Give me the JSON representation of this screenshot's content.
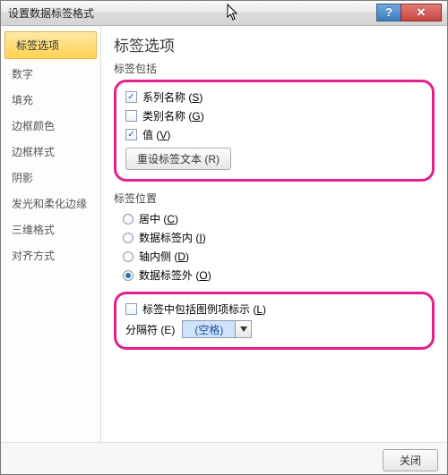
{
  "window": {
    "title": "设置数据标签格式"
  },
  "sidebar": {
    "items": [
      {
        "label": "标签选项"
      },
      {
        "label": "数字"
      },
      {
        "label": "填充"
      },
      {
        "label": "边框颜色"
      },
      {
        "label": "边框样式"
      },
      {
        "label": "阴影"
      },
      {
        "label": "发光和柔化边缘"
      },
      {
        "label": "三维格式"
      },
      {
        "label": "对齐方式"
      }
    ]
  },
  "content": {
    "title": "标签选项",
    "contains_label": "标签包括",
    "series_name": "系列名称",
    "series_mn": "S",
    "category_name": "类别名称",
    "category_mn": "G",
    "value": "值",
    "value_mn": "V",
    "reset_btn": "重设标签文本",
    "reset_mn": "R",
    "position_label": "标签位置",
    "pos_center": "居中",
    "pos_center_mn": "C",
    "pos_inside": "数据标签内",
    "pos_inside_mn": "I",
    "pos_axis": "轴内侧",
    "pos_axis_mn": "D",
    "pos_outside": "数据标签外",
    "pos_outside_mn": "O",
    "legend_key": "标签中包括图例项标示",
    "legend_key_mn": "L",
    "separator_label": "分隔符",
    "separator_mn": "E",
    "separator_value": "(空格)"
  },
  "footer": {
    "close": "关闭"
  }
}
